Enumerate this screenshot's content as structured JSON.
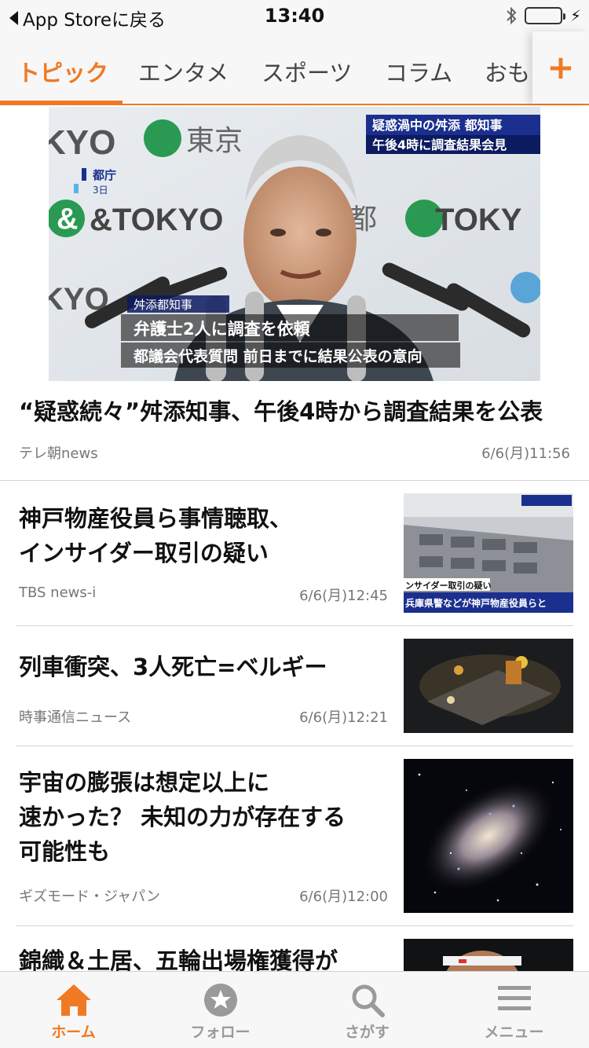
{
  "status_bar": {
    "back_label": "App Storeに戻る",
    "time": "13:40",
    "icons": [
      "bluetooth-icon",
      "battery-icon",
      "charging-icon"
    ]
  },
  "tabs": {
    "items": [
      {
        "label": "トピック",
        "active": true
      },
      {
        "label": "エンタメ",
        "active": false
      },
      {
        "label": "スポーツ",
        "active": false
      },
      {
        "label": "コラム",
        "active": false
      },
      {
        "label": "おも",
        "active": false
      }
    ],
    "add_label": "+"
  },
  "hero": {
    "image_caption_1": "疑惑渦中の舛添 都知事",
    "image_caption_2": "午後4時に調査結果会見",
    "image_place": "都庁",
    "image_day": "3日",
    "image_name": "舛添都知事",
    "image_line_1": "弁護士2人に調査を依頼",
    "image_line_2": "都議会代表質問 前日までに結果公表の意向",
    "image_brand": "&TOKYO",
    "title": "“疑惑続々”舛添知事、午後4時から調査結果を公表",
    "source": "テレ朝news",
    "date": "6/6(月)11:56"
  },
  "articles": [
    {
      "title_lines": [
        "神戸物産役員ら事情聴取、",
        "インサイダー取引の疑い"
      ],
      "source": "TBS news-i",
      "date": "6/6(月)12:45",
      "thumb_caption_1": "ンサイダー取引の疑い",
      "thumb_caption_2": "兵庫県警などが神戸物産役員らと"
    },
    {
      "title_lines": [
        "列車衝突、3人死亡=ベルギー"
      ],
      "source": "時事通信ニュース",
      "date": "6/6(月)12:21"
    },
    {
      "title_lines": [
        "宇宙の膨張は想定以上に",
        "速かった？ 未知の力が存在する",
        "可能性も"
      ],
      "source": "ギズモード・ジャパン",
      "date": "6/6(月)12:00"
    },
    {
      "title_lines": [
        "錦織＆土居、五輪出場権獲得が"
      ],
      "source": "",
      "date": ""
    }
  ],
  "bottom_nav": {
    "items": [
      {
        "label": "ホーム",
        "icon": "home-icon",
        "active": true
      },
      {
        "label": "フォロー",
        "icon": "star-icon",
        "active": false
      },
      {
        "label": "さがす",
        "icon": "search-icon",
        "active": false
      },
      {
        "label": "メニュー",
        "icon": "menu-icon",
        "active": false
      }
    ]
  },
  "colors": {
    "accent": "#f07a24",
    "inactive": "#9a9a9a",
    "battery": "#4cd964"
  }
}
